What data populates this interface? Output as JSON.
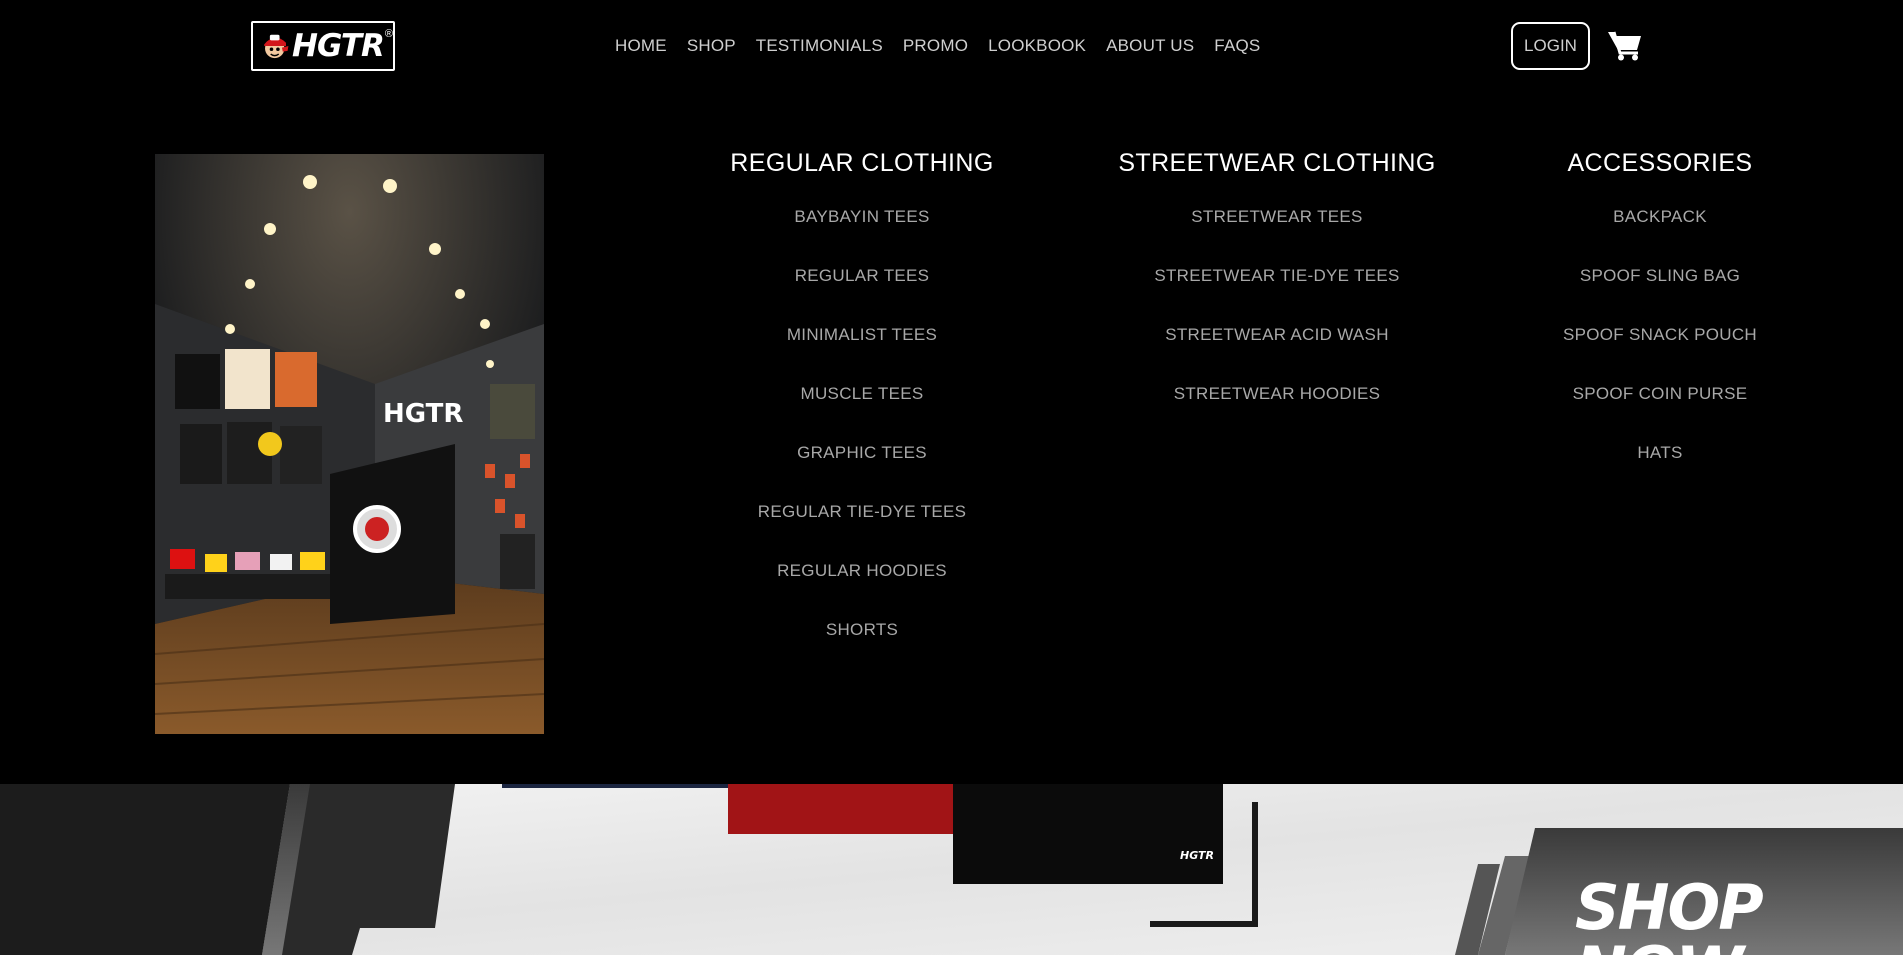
{
  "brand": {
    "logo_text": "HGTR",
    "logo_mark": "®"
  },
  "nav": {
    "items": [
      "HOME",
      "SHOP",
      "TESTIMONIALS",
      "PROMO",
      "LOOKBOOK",
      "ABOUT US",
      "FAQS"
    ],
    "login_label": "LOGIN",
    "cart_icon": "shopping-cart-icon"
  },
  "store_photo": {
    "sign_text": "HGTR"
  },
  "mega_menu": {
    "regular": {
      "title": "REGULAR CLOTHING",
      "items": [
        "BAYBAYIN TEES",
        "REGULAR TEES",
        "MINIMALIST TEES",
        "MUSCLE TEES",
        "GRAPHIC TEES",
        "REGULAR TIE-DYE TEES",
        "REGULAR HOODIES",
        "SHORTS"
      ]
    },
    "streetwear": {
      "title": "STREETWEAR CLOTHING",
      "items": [
        "STREETWEAR TEES",
        "STREETWEAR TIE-DYE TEES",
        "STREETWEAR ACID WASH",
        "STREETWEAR HOODIES"
      ]
    },
    "accessories": {
      "title": "ACCESSORIES",
      "items": [
        "BACKPACK",
        "SPOOF SLING BAG",
        "SPOOF SNACK POUCH",
        "SPOOF COIN PURSE",
        "HATS"
      ]
    }
  },
  "hero": {
    "cta_label": "SHOP NOW",
    "shirt_tag": "HGTR"
  },
  "colors": {
    "background": "#000000",
    "nav_text": "#cfcfcf",
    "menu_item": "#a8a8a8",
    "heading": "#ffffff",
    "shirt_red": "#a11416"
  }
}
